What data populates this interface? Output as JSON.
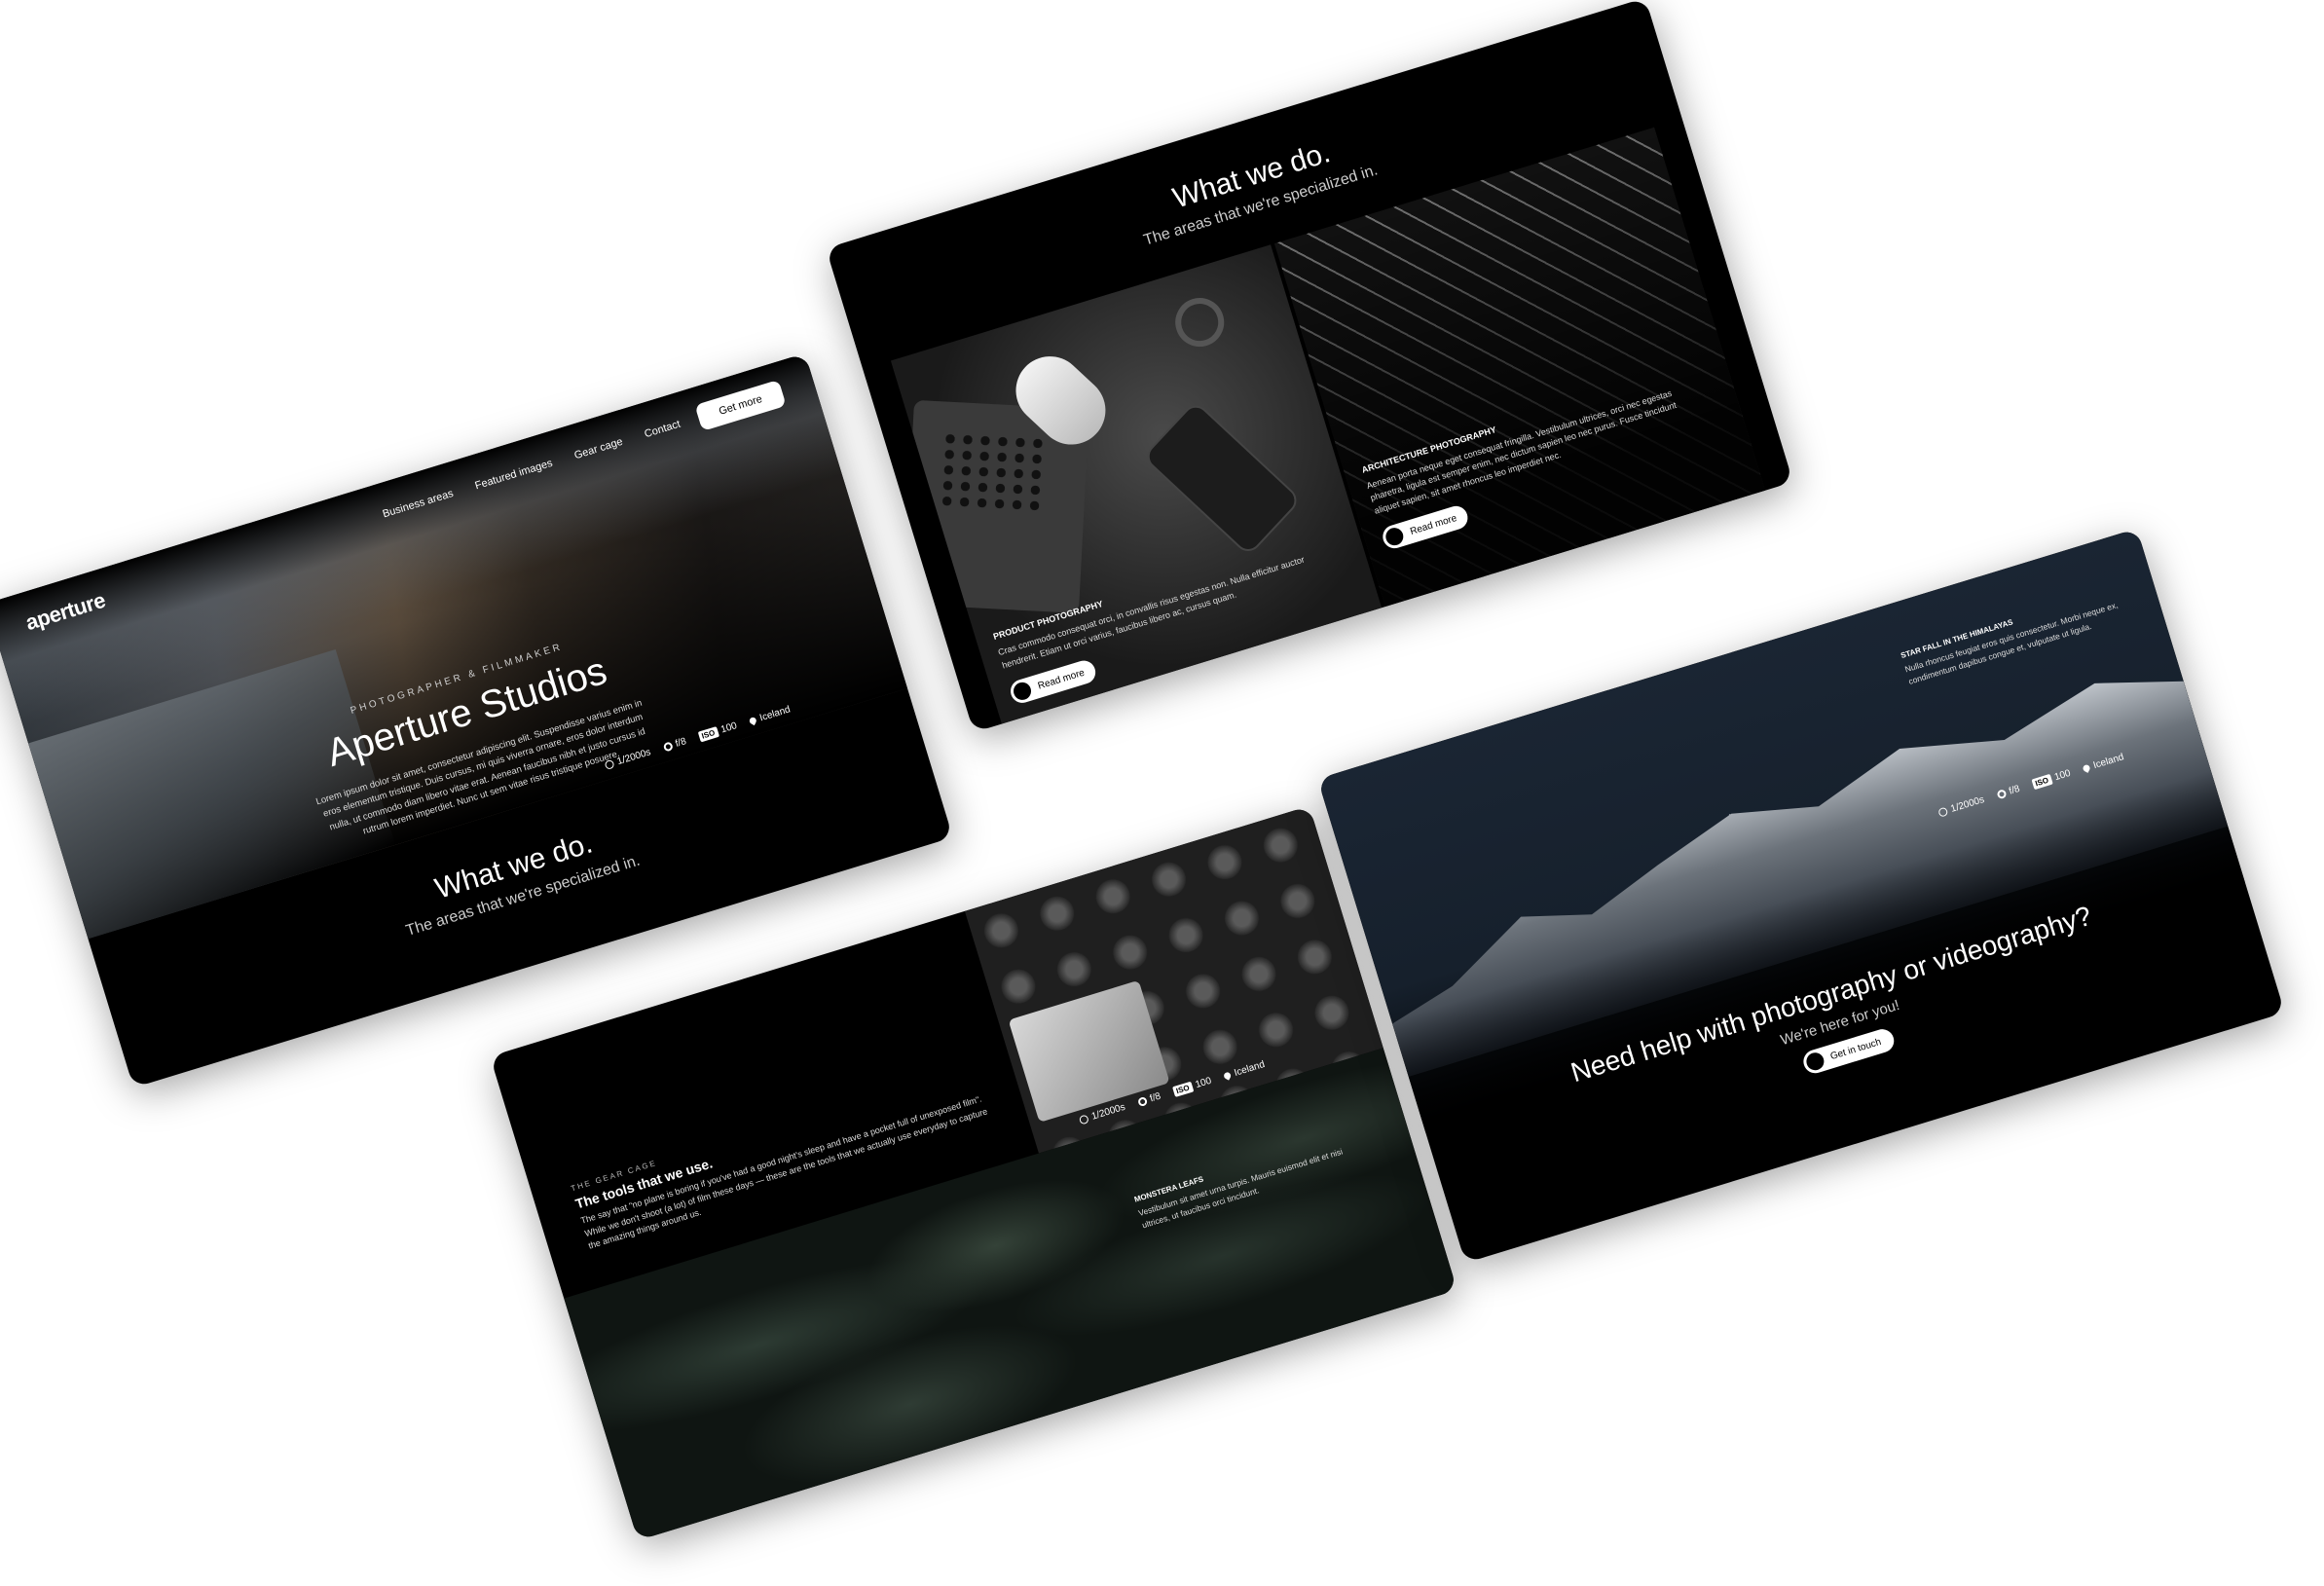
{
  "hero": {
    "logo": "aperture",
    "nav": [
      "Business areas",
      "Featured images",
      "Gear cage",
      "Contact"
    ],
    "cta": "Get more",
    "eyebrow": "PHOTOGRAPHER & FILMMAKER",
    "title": "Aperture Studios",
    "body": "Lorem ipsum dolor sit amet, consectetur adipiscing elit. Suspendisse varius enim in eros elementum tristique. Duis cursus, mi quis viverra ornare, eros dolor interdum nulla, ut commodo diam libero vitae erat. Aenean faucibus nibh et justo cursus id rutrum lorem imperdiet. Nunc ut sem vitae risus tristique posuere.",
    "meta": {
      "shutter": "1/2000s",
      "aperture": "f/8",
      "iso_badge": "ISO",
      "iso": "100",
      "location": "Iceland"
    }
  },
  "section": {
    "title": "What we do.",
    "subtitle": "The areas that we're specialized in."
  },
  "tiles": [
    {
      "label": "PRODUCT PHOTOGRAPHY",
      "body": "Cras commodo consequat orci, in convallis risus egestas non. Nulla efficitur auctor hendrerit. Etiam ut orci varius, faucibus libero ac, cursus quam.",
      "button": "Read more"
    },
    {
      "label": "ARCHITECTURE PHOTOGRAPHY",
      "body": "Aenean porta neque eget consequat fringilla. Vestibulum ultrices, orci nec egestas pharetra, ligula est semper enim, nec dictum sapien leo nec purus. Fusce tincidunt aliquet sapien, sit amet rhoncus leo imperdiet nec.",
      "button": "Read more"
    }
  ],
  "gear": {
    "eyebrow": "THE GEAR CAGE",
    "title": "The tools that we use.",
    "body": "The say that \"no plane is boring if you've had a good night's sleep and have a pocket full of unexposed film\". While we don't shoot (a lot) of film these days — these are the tools that we actually use everyday to capture the amazing things around us.",
    "meta": {
      "shutter": "1/2000s",
      "aperture": "f/8",
      "iso_badge": "ISO",
      "iso": "100",
      "location": "Iceland"
    },
    "leaf_label": "MONSTERA LEAFS",
    "leaf_body": "Vestibulum sit amet urna turpis. Mauris euismod elit et nisi ultrices, ut faucibus orci tincidunt."
  },
  "contact": {
    "photo_label": "STAR FALL IN THE HIMALAYAS",
    "photo_body": "Nulla rhoncus feugiat eros quis consectetur. Morbi neque ex, condimentum dapibus congue et, vulputate ut ligula.",
    "meta": {
      "shutter": "1/2000s",
      "aperture": "f/8",
      "iso_badge": "ISO",
      "iso": "100",
      "location": "Iceland"
    },
    "title": "Need help with photography or videography?",
    "subtitle": "We're here for you!",
    "button": "Get in touch"
  }
}
